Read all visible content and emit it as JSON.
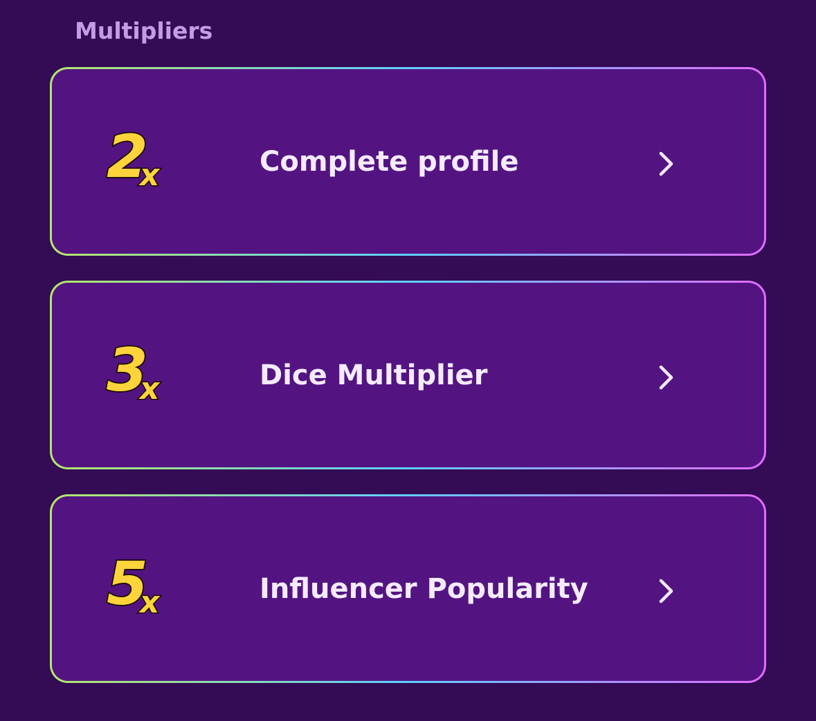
{
  "section": {
    "title": "Multipliers"
  },
  "multipliers": [
    {
      "badge_number": "2",
      "badge_suffix": "x",
      "label": "Complete profile",
      "action_icon": "chevron-right-icon"
    },
    {
      "badge_number": "3",
      "badge_suffix": "x",
      "label": "Dice Multiplier",
      "action_icon": "chevron-right-icon"
    },
    {
      "badge_number": "5",
      "badge_suffix": "x",
      "label": "Influencer Popularity",
      "action_icon": "chevron-right-icon"
    }
  ],
  "colors": {
    "background": "#340b55",
    "card_fill": "#531481",
    "card_border_gradient": [
      "#b5e86a",
      "#5fcfff",
      "#e36bff"
    ],
    "title_text": "#c49be6",
    "label_text": "#f4ebff",
    "badge_fill": "#ffd43b",
    "badge_outline": "#1a0a05"
  }
}
